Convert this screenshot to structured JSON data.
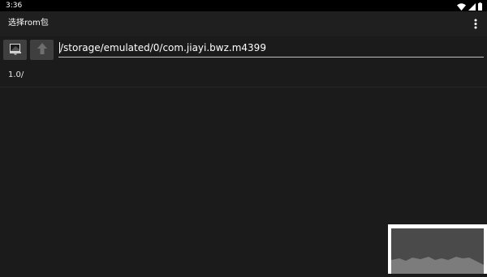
{
  "status_bar": {
    "time": "3:36",
    "icons": [
      "wifi-icon",
      "cell-signal-icon",
      "battery-icon"
    ]
  },
  "app_bar": {
    "title": "选择rom包",
    "menu_icon": "overflow-menu-icon"
  },
  "toolbar": {
    "home_icon": "home-folder-icon",
    "up_icon": "up-arrow-icon",
    "path": "/storage/emulated/0/com.jiayi.bwz.m4399"
  },
  "file_list": {
    "items": [
      {
        "name": "1.0/"
      }
    ]
  },
  "colors": {
    "background": "#1b1b1b",
    "status_bar": "#000000",
    "action_bar": "#1f1f1f",
    "button": "#3f3f3f",
    "underline": "#bdbdbd"
  }
}
